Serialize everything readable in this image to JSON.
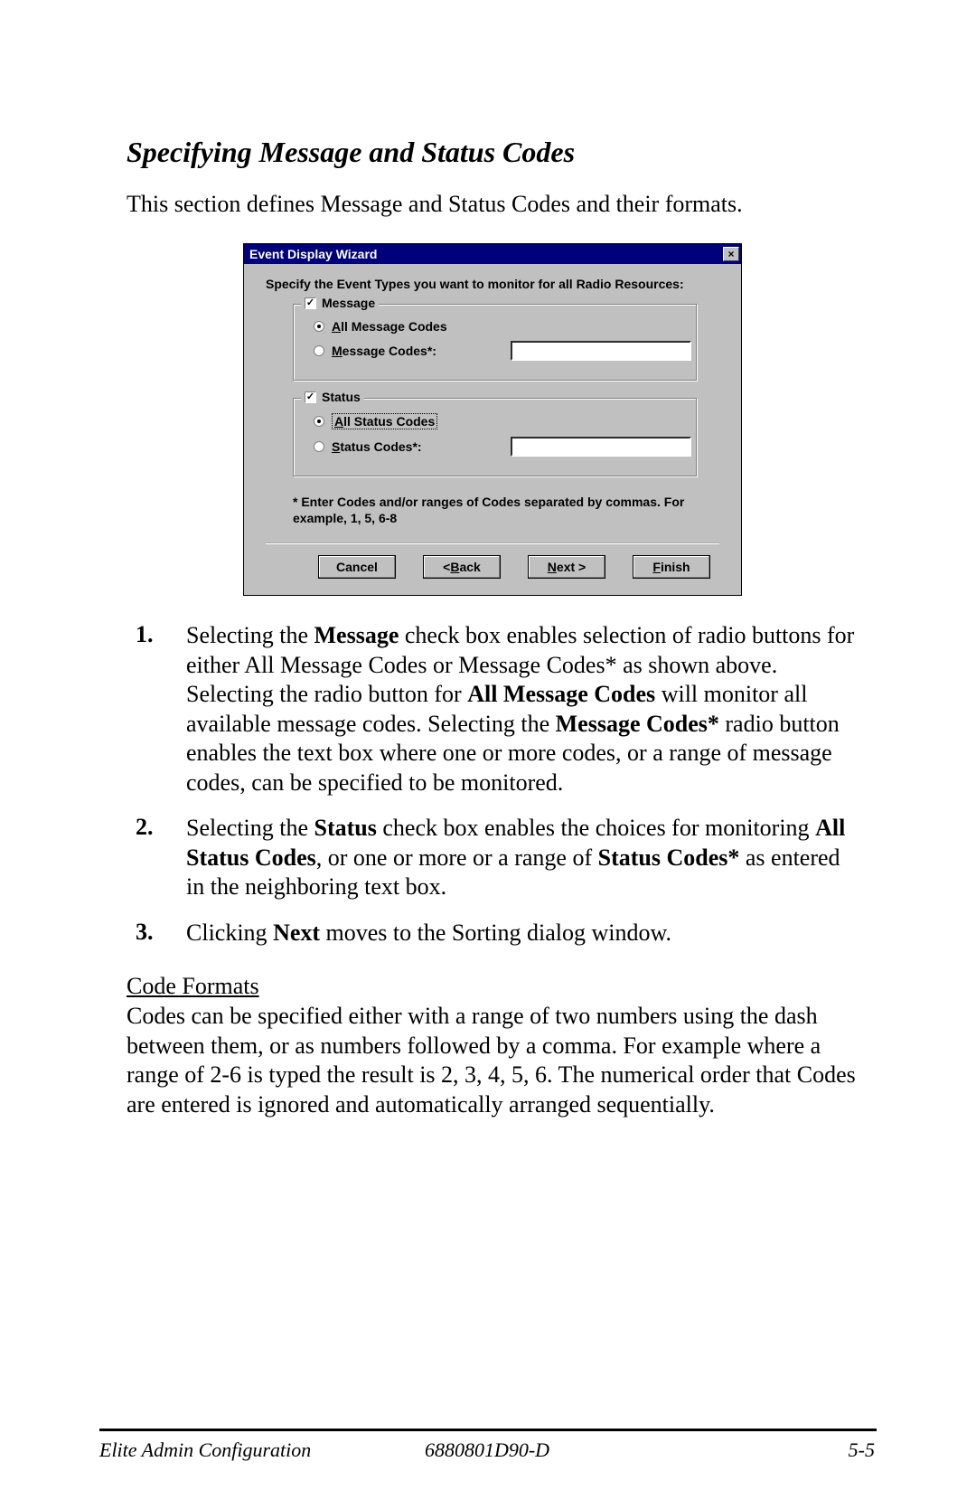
{
  "section_title": "Specifying Message and Status Codes",
  "intro": "This section defines Message and Status Codes and their formats.",
  "dialog": {
    "title": "Event Display Wizard",
    "instruction": "Specify the Event Types you want to monitor for all Radio Resources:",
    "groups": {
      "message": {
        "legend": "Message",
        "checked": true,
        "radio_all": "All Message Codes",
        "radio_all_ul_char": "A",
        "radio_specific": "Message Codes*:",
        "radio_specific_ul_char": "M",
        "selected": "all",
        "input_value": ""
      },
      "status": {
        "legend": "Status",
        "checked": true,
        "radio_all": "All Status Codes",
        "radio_all_ul_char": "A",
        "radio_specific": "Status Codes*:",
        "radio_specific_ul_char": "S",
        "selected": "all",
        "input_value": ""
      }
    },
    "hint": "* Enter Codes and/or ranges of Codes separated by commas. For example, 1, 5, 6-8",
    "buttons": {
      "cancel": "Cancel",
      "back": "Back",
      "next": "Next",
      "finish": "Finish",
      "back_ul_char": "B",
      "next_ul_char": "N",
      "finish_ul_char": "F"
    }
  },
  "steps": [
    {
      "num": "1.",
      "parts": [
        "Selecting the ",
        "Message",
        " check box enables selection of radio buttons for either All Message Codes or Message Codes* as shown above. Selecting the radio button for ",
        "All Message Codes",
        " will monitor all available message codes.  Selecting the  ",
        "Message Codes*",
        " radio button enables the text box where one or more codes, or a range of message codes, can be specified to be monitored."
      ]
    },
    {
      "num": "2.",
      "parts": [
        "Selecting the ",
        "Status",
        " check box enables the choices for monitoring ",
        "All Status Codes",
        ", or one or more or a range of ",
        "Status Codes*",
        " as entered in the neighboring text box."
      ]
    },
    {
      "num": "3.",
      "parts": [
        "Clicking ",
        "Next",
        " moves to the Sorting dialog window."
      ]
    }
  ],
  "code_formats": {
    "heading": "Code Formats",
    "body": "Codes can be specified either with a range of two numbers using the dash between them, or as numbers followed by a comma.  For example where a range of 2-6 is typed the result is 2, 3, 4, 5, 6.  The numerical order that Codes are entered is ignored and automatically arranged sequentially."
  },
  "footer": {
    "left": "Elite Admin Configuration",
    "center": "6880801D90-D",
    "right": "5-5"
  }
}
